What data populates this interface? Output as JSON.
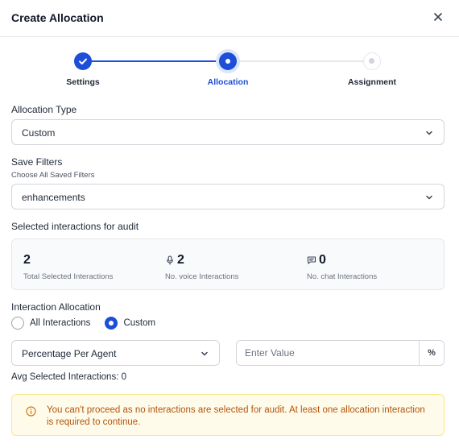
{
  "dialog": {
    "title": "Create Allocation"
  },
  "stepper": {
    "steps": [
      {
        "label": "Settings",
        "state": "done"
      },
      {
        "label": "Allocation",
        "state": "active"
      },
      {
        "label": "Assignment",
        "state": "pending"
      }
    ]
  },
  "allocation_type": {
    "label": "Allocation Type",
    "value": "Custom"
  },
  "save_filters": {
    "label": "Save Filters",
    "sublabel": "Choose All Saved Filters",
    "value": "enhancements"
  },
  "selected": {
    "label": "Selected interactions for audit",
    "total": {
      "count": "2",
      "caption": "Total Selected Interactions"
    },
    "voice": {
      "count": "2",
      "caption": "No. voice Interactions",
      "icon": "microphone-icon"
    },
    "chat": {
      "count": "0",
      "caption": "No. chat Interactions",
      "icon": "chat-icon"
    }
  },
  "interaction_allocation": {
    "label": "Interaction Allocation",
    "options": [
      {
        "label": "All Interactions",
        "selected": false
      },
      {
        "label": "Custom",
        "selected": true
      }
    ]
  },
  "agent_split": {
    "value": "Percentage Per Agent"
  },
  "value_input": {
    "placeholder": "Enter Value",
    "unit": "%"
  },
  "avg": {
    "text": "Avg Selected Interactions: 0"
  },
  "alert": {
    "text": "You can't proceed as no interactions are selected for audit. At least one allocation interaction is required to continue.",
    "color": "#b45309",
    "icon": "info-icon"
  },
  "colors": {
    "primary": "#1d4ed8",
    "warning_bg": "#fffbeb",
    "warning_border": "#fde68a"
  }
}
